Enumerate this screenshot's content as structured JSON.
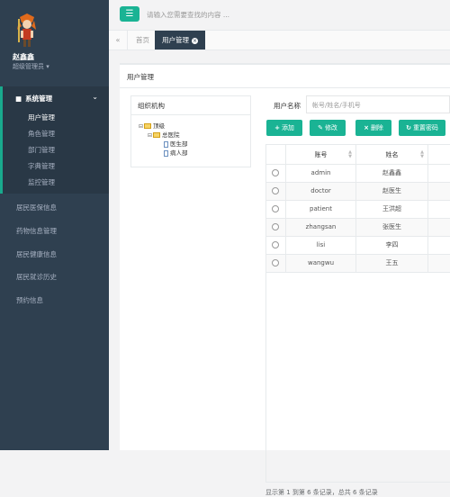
{
  "sidebar": {
    "user_name": "赵鑫鑫",
    "user_role": "超级管理员 ▾",
    "menu_open": {
      "label": "系统管理",
      "icon": "user-icon"
    },
    "submenu": [
      "用户管理",
      "角色管理",
      "部门管理",
      "字典管理",
      "监控管理"
    ],
    "items": [
      "居民医保信息",
      "药物信息管理",
      "居民健康信息",
      "居民就诊历史",
      "预约信息"
    ]
  },
  "topbar": {
    "search_placeholder": "请输入您需要查找的内容 ..."
  },
  "tabs": {
    "home": "首页",
    "active": "用户管理"
  },
  "panel": {
    "title": "用户管理",
    "org_title": "组织机构",
    "tree": {
      "root": "顶级",
      "branch": "总医院",
      "leaf1": "医生部",
      "leaf2": "病人部"
    },
    "search_label": "用户名称",
    "search_placeholder": "帐号/姓名/手机号",
    "buttons": {
      "add": "添加",
      "edit": "修改",
      "delete": "删除",
      "reset": "重置密码"
    },
    "columns": {
      "account": "账号",
      "name": "姓名"
    },
    "rows": [
      {
        "account": "admin",
        "name": "赵鑫鑫"
      },
      {
        "account": "doctor",
        "name": "赵医生"
      },
      {
        "account": "patient",
        "name": "王洪超"
      },
      {
        "account": "zhangsan",
        "name": "张医生"
      },
      {
        "account": "lisi",
        "name": "李四"
      },
      {
        "account": "wangwu",
        "name": "王五"
      }
    ],
    "footer": "显示第 1 到第 6 条记录，总共 6 条记录"
  },
  "colors": {
    "accent": "#1ab394",
    "sidebar": "#2f4050",
    "sidebar_active": "#293846"
  }
}
